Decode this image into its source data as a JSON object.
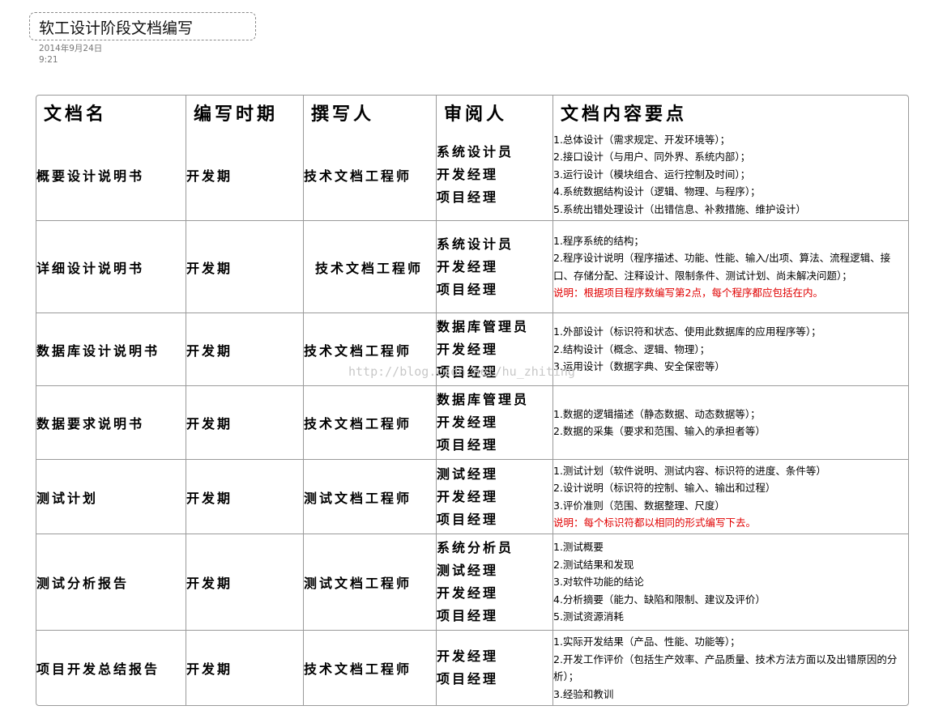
{
  "page": {
    "title": "软工设计阶段文档编写",
    "date": "2014年9月24日",
    "time": "9:21"
  },
  "table": {
    "headers": [
      "文档名",
      "编写时期",
      "撰写人",
      "审阅人",
      "文档内容要点"
    ],
    "rows": [
      {
        "name": "概要设计说明书",
        "period": "开发期",
        "author": "技术文档工程师",
        "reviewers": [
          "系统设计员",
          "开发经理",
          "项目经理"
        ],
        "content": [
          "1.总体设计（需求规定、开发环境等）；",
          "2.接口设计（与用户、同外界、系统内部）；",
          "3.运行设计（模块组合、运行控制及时间）；",
          "4.系统数据结构设计（逻辑、物理、与程序）；",
          "5.系统出错处理设计（出错信息、补救措施、维护设计）"
        ],
        "note": ""
      },
      {
        "name": "详细设计说明书",
        "period": "开发期",
        "author": "技术文档工程师",
        "reviewers": [
          "系统设计员",
          "开发经理",
          "项目经理"
        ],
        "content": [
          "1.程序系统的结构；",
          "2.程序设计说明（程序描述、功能、性能、输入/出项、算法、流程逻辑、接口、存储分配、注释设计、限制条件、测试计划、尚未解决问题）；"
        ],
        "note": "说明：根据项目程序数编写第2点，每个程序都应包括在内。"
      },
      {
        "name": "数据库设计说明书",
        "period": "开发期",
        "author": "技术文档工程师",
        "reviewers": [
          "数据库管理员",
          "开发经理",
          "项目经理"
        ],
        "content": [
          "1.外部设计（标识符和状态、使用此数据库的应用程序等）；",
          "2.结构设计（概念、逻辑、物理）；",
          "3.运用设计（数据字典、安全保密等）"
        ],
        "note": ""
      },
      {
        "name": "数据要求说明书",
        "period": "开发期",
        "author": "技术文档工程师",
        "reviewers": [
          "数据库管理员",
          "开发经理",
          "项目经理"
        ],
        "content": [
          "1.数据的逻辑描述（静态数据、动态数据等）；",
          "2.数据的采集（要求和范围、输入的承担者等）"
        ],
        "note": ""
      },
      {
        "name": "测试计划",
        "period": "开发期",
        "author": "测试文档工程师",
        "reviewers": [
          "测试经理",
          "开发经理",
          "项目经理"
        ],
        "content": [
          "1.测试计划（软件说明、测试内容、标识符的进度、条件等）",
          "2.设计说明（标识符的控制、输入、输出和过程）",
          "3.评价准则（范围、数据整理、尺度）"
        ],
        "note": "说明：每个标识符都以相同的形式编写下去。"
      },
      {
        "name": "测试分析报告",
        "period": "开发期",
        "author": "测试文档工程师",
        "reviewers": [
          "系统分析员",
          "测试经理",
          "开发经理",
          "项目经理"
        ],
        "content": [
          "1.测试概要",
          "2.测试结果和发现",
          "3.对软件功能的结论",
          "4.分析摘要（能力、缺陷和限制、建议及评价）",
          "5.测试资源消耗"
        ],
        "note": ""
      },
      {
        "name": "项目开发总结报告",
        "period": "开发期",
        "author": "技术文档工程师",
        "reviewers": [
          "开发经理",
          "项目经理"
        ],
        "content": [
          "1.实际开发结果（产品、性能、功能等）；",
          "2.开发工作评价（包括生产效率、产品质量、技术方法方面以及出错原因的分析）；",
          "3.经验和教训"
        ],
        "note": ""
      }
    ]
  },
  "watermark": "http://blog.csdn.net/hu_zhiting"
}
